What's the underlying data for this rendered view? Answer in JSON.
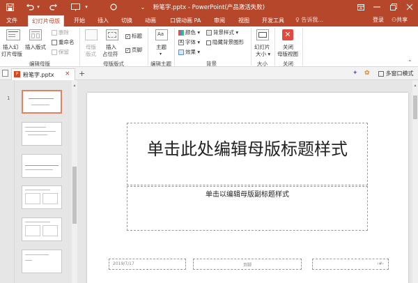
{
  "window": {
    "title": "粉笔字.pptx - PowerPoint(产品激活失败)",
    "accent": "#b7472a"
  },
  "quick_access": [
    "save-icon",
    "undo-icon",
    "redo-icon",
    "start-slideshow-icon",
    "shape-circle-icon",
    "customize-icon"
  ],
  "tabs": [
    {
      "label": "文件"
    },
    {
      "label": "幻灯片母版",
      "active": true
    },
    {
      "label": "开始"
    },
    {
      "label": "插入"
    },
    {
      "label": "切换"
    },
    {
      "label": "动画"
    },
    {
      "label": "口袋动画 PA"
    },
    {
      "label": "审阅"
    },
    {
      "label": "视图"
    },
    {
      "label": "开发工具"
    }
  ],
  "tell_me": "告诉我...",
  "account": {
    "login": "登录",
    "share": "共享"
  },
  "ribbon": {
    "edit_master": {
      "label": "编辑母版",
      "insert_slide_master": [
        "插入幻",
        "灯片母版"
      ],
      "insert_layout": "插入版式",
      "delete": "删除",
      "rename": "重命名",
      "preserve": "保留"
    },
    "master_layout": {
      "label": "母版版式",
      "master_layout_btn": [
        "母版",
        "版式"
      ],
      "insert_placeholder": [
        "插入",
        "占位符"
      ],
      "title_check": "标题",
      "footer_check": "页脚"
    },
    "edit_theme": {
      "label": "编辑主题",
      "themes": "主题"
    },
    "background": {
      "label": "背景",
      "colors": "颜色",
      "fonts": "字体",
      "effects": "效果",
      "background_styles": "背景样式",
      "hide_background": "隐藏背景图形"
    },
    "size": {
      "label": "大小",
      "slide_size": [
        "幻灯片",
        "大小"
      ]
    },
    "close": {
      "label": "关闭",
      "close_master_view": [
        "关闭",
        "母版视图"
      ]
    }
  },
  "doc_tab": {
    "name": "粉笔字.pptx"
  },
  "multi_window": "多窗口模式",
  "slide": {
    "title": "单击此处编辑母版标题样式",
    "subtitle": "单击以编辑母版副标题样式",
    "date": "2019/7/17",
    "footer": "页脚",
    "number": "‹#›"
  }
}
